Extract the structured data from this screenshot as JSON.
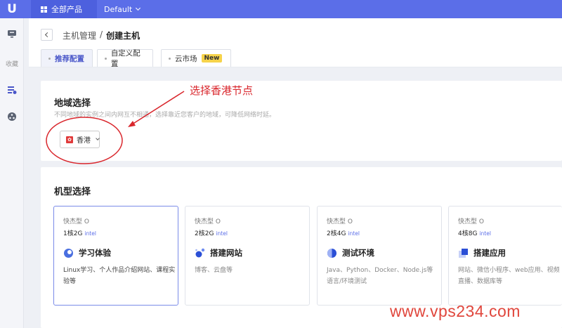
{
  "topbar": {
    "logo": "U",
    "all_products": "全部产品",
    "project": "Default"
  },
  "sidebar": {
    "favorites_label": "收藏"
  },
  "breadcrumb": {
    "parent": "主机管理",
    "separator": "/",
    "current": "创建主机"
  },
  "tabs": [
    {
      "label": "推荐配置"
    },
    {
      "label": "自定义配置"
    },
    {
      "label": "云市场",
      "badge": "New"
    }
  ],
  "region_section": {
    "title": "地域选择",
    "description": "不同地域的实例之间内网互不相通，选择靠近您客户的地域，可降低网络时延。",
    "selected_region": "香港"
  },
  "annotation": {
    "text": "选择香港节点",
    "color": "#d9262c"
  },
  "instance_section": {
    "title": "机型选择",
    "specs": [
      {
        "type": "快杰型 O",
        "config": "1核2G",
        "cpu": "intel",
        "name": "学习体验",
        "usage": "Linux学习、个人作品介绍网站、课程实验等"
      },
      {
        "type": "快杰型 O",
        "config": "2核2G",
        "cpu": "intel",
        "name": "搭建网站",
        "usage": "博客、云盘等"
      },
      {
        "type": "快杰型 O",
        "config": "2核4G",
        "cpu": "intel",
        "name": "测试环境",
        "usage": "Java、Python、Docker、Node.js等语言/环境测试"
      },
      {
        "type": "快杰型 O",
        "config": "4核8G",
        "cpu": "intel",
        "name": "搭建应用",
        "usage": "网站、微信小程序、web应用、视频直播、数据库等"
      }
    ]
  },
  "watermark": "www.vps234.com",
  "colors": {
    "brand": "#5b6ee8",
    "annotation": "#d9262c"
  }
}
